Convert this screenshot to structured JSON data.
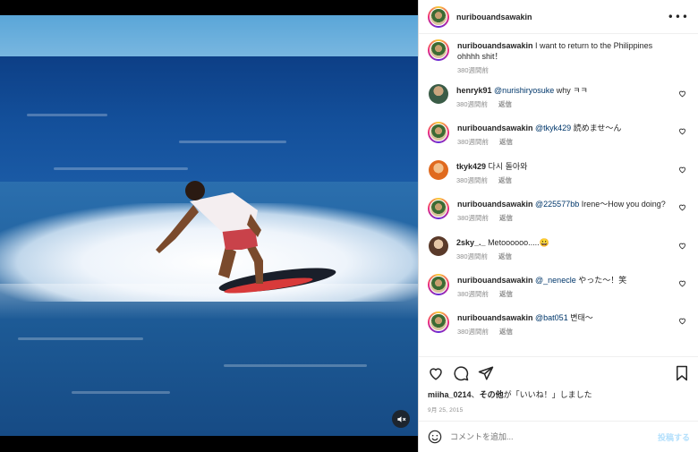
{
  "post": {
    "username": "nuribouandsawakin",
    "caption_user": "nuribouandsawakin",
    "caption_text": "I want to return to the Philippines ohhhh shit！",
    "caption_time": "380週間前"
  },
  "comments": [
    {
      "user": "henryk91",
      "mention": "@nurishiryosuke",
      "text": "why ㅋㅋ",
      "time": "380週間前",
      "reply": "返信",
      "avatar": "photo-dark"
    },
    {
      "user": "nuribouandsawakin",
      "mention": "@tkyk429",
      "text": "読めませ〜ん",
      "time": "380週間前",
      "reply": "返信",
      "avatar": "ring"
    },
    {
      "user": "tkyk429",
      "mention": "",
      "text": "다시 돌아와",
      "time": "380週間前",
      "reply": "返信",
      "avatar": "photo-orange"
    },
    {
      "user": "nuribouandsawakin",
      "mention": "@225577bb",
      "text": "Irene〜How you doing?",
      "time": "380週間前",
      "reply": "返信",
      "avatar": "ring"
    },
    {
      "user": "2sky_._",
      "mention": "",
      "text": "Metoooooo.....😀",
      "time": "380週間前",
      "reply": "返信",
      "avatar": "photo-brown"
    },
    {
      "user": "nuribouandsawakin",
      "mention": "@_nenecle",
      "text": "やった〜！笑",
      "time": "380週間前",
      "reply": "返信",
      "avatar": "ring"
    },
    {
      "user": "nuribouandsawakin",
      "mention": "@bat051",
      "text": "변태〜",
      "time": "380週間前",
      "reply": "返信",
      "avatar": "ring"
    }
  ],
  "likes": {
    "user": "miiha_0214",
    "sep": "、",
    "others": "その他",
    "suffix": "が「いいね！」しました"
  },
  "date": "9月 25, 2015",
  "comment_box": {
    "placeholder": "コメントを追加...",
    "post_label": "投稿する"
  },
  "icons": {
    "more": "more-options-icon",
    "like": "heart-icon",
    "comment": "comment-icon",
    "share": "share-icon",
    "save": "bookmark-icon",
    "emoji": "emoji-icon",
    "mute": "muted-speaker-icon"
  },
  "colors": {
    "mention": "#00376b",
    "muted_text": "#8e8e8e",
    "post_button": "#b2dffc"
  }
}
